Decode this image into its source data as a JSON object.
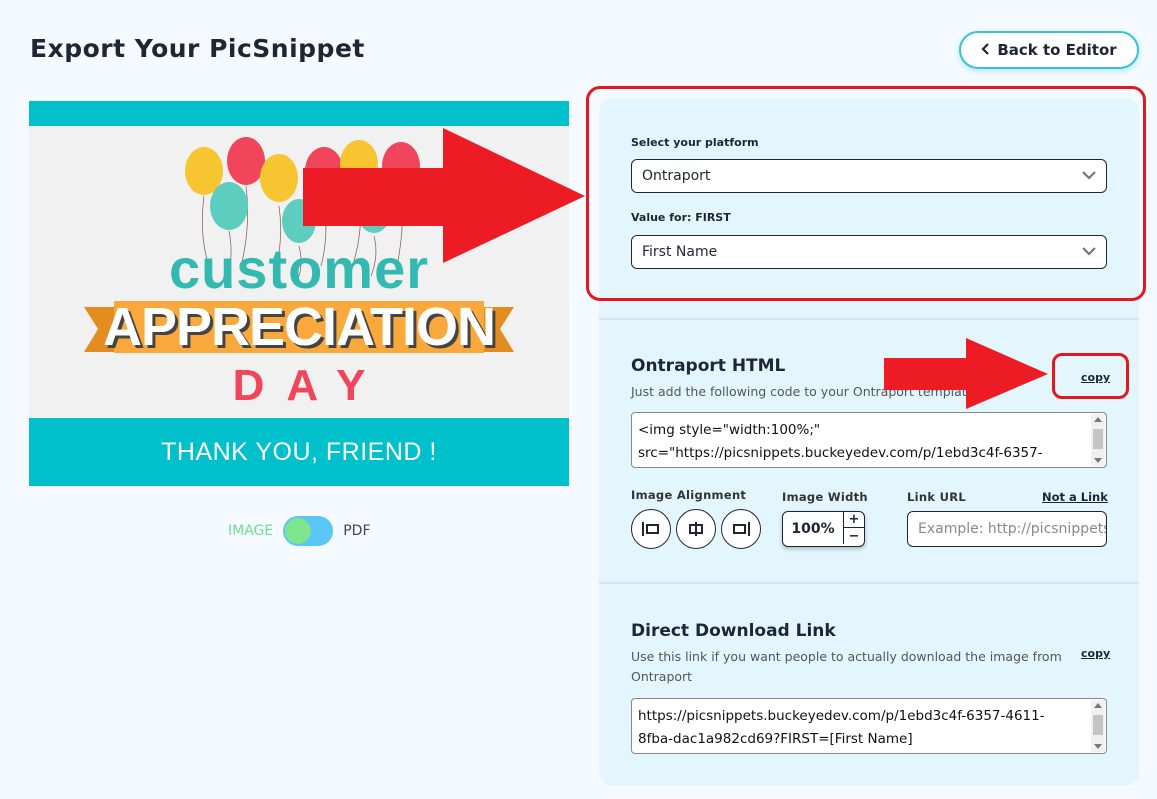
{
  "header": {
    "title": "Export Your PicSnippet",
    "back_button": "Back to Editor",
    "back_icon": "chevron-left-icon"
  },
  "preview": {
    "line1": "customer",
    "line2": "APPRECIATION",
    "line3": "DAY",
    "footer_text": "THANK YOU,  FRIEND !",
    "colors": {
      "teal": "#00c0cb",
      "ribbon": "#f9a83b",
      "red": "#f1455a",
      "green_text": "#34b9b1"
    }
  },
  "format_toggle": {
    "left_label": "IMAGE",
    "right_label": "PDF",
    "selected": "IMAGE"
  },
  "platform": {
    "label": "Select your platform",
    "value": "Ontraport",
    "merge_label": "Value for: FIRST",
    "merge_value": "First Name"
  },
  "html_section": {
    "title": "Ontraport HTML",
    "description": "Just add the following code to your Ontraport template",
    "copy_label": "copy",
    "code_line1": "<img style=\"width:100%;\"",
    "code_line2": "src=\"https://picsnippets.buckeyedev.com/p/1ebd3c4f-6357-"
  },
  "options": {
    "alignment_label": "Image Alignment",
    "alignment_icons": [
      "align-left-icon",
      "align-center-icon",
      "align-right-icon"
    ],
    "width_label": "Image Width",
    "width_value": "100%",
    "plus": "+",
    "minus": "−",
    "link_label": "Link URL",
    "not_link": "Not a Link",
    "link_placeholder": "Example: http://picsnippets.com"
  },
  "download_section": {
    "title": "Direct Download Link",
    "description_line1": "Use this link if you want people to actually download the image from",
    "description_line2": "Ontraport",
    "copy_label": "copy",
    "link_line1": "https://picsnippets.buckeyedev.com/p/1ebd3c4f-6357-4611-",
    "link_line2": "8fba-dac1a982cd69?FIRST=[First Name]"
  },
  "annotation_color": "#e3181f"
}
